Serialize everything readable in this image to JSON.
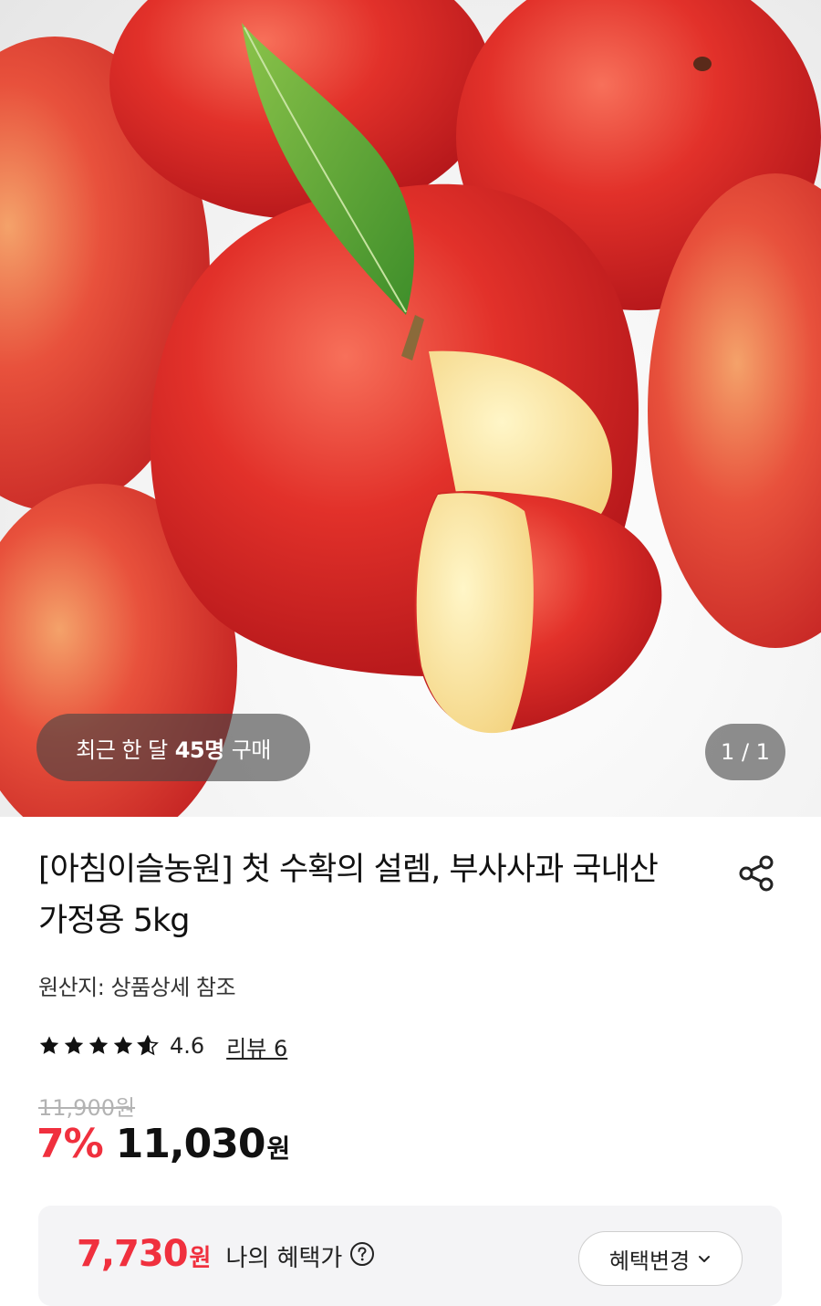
{
  "gallery": {
    "recent_buy_prefix": "최근 한 달",
    "recent_buy_count": "45명",
    "recent_buy_suffix": "구매",
    "counter": "1 / 1"
  },
  "product": {
    "title": "[아침이슬농원] 첫 수확의 설렘, 부사사과 국내산 가정용 5kg",
    "origin": "원산지: 상품상세 참조",
    "rating": "4.6",
    "rating_value": 4.6,
    "review_link": "리뷰 6",
    "original_price": "11,900원",
    "discount": "7%",
    "sale_price": "11,030",
    "currency": "원"
  },
  "benefit": {
    "price": "7,730",
    "currency": "원",
    "label": "나의 혜택가",
    "change_button": "혜택변경"
  },
  "colors": {
    "accent_red": "#f0303e",
    "box_bg": "#f4f4f6"
  },
  "icons": {
    "share": "share-icon",
    "help": "question-circle-icon",
    "chevron": "chevron-down-icon",
    "star": "star-icon"
  }
}
